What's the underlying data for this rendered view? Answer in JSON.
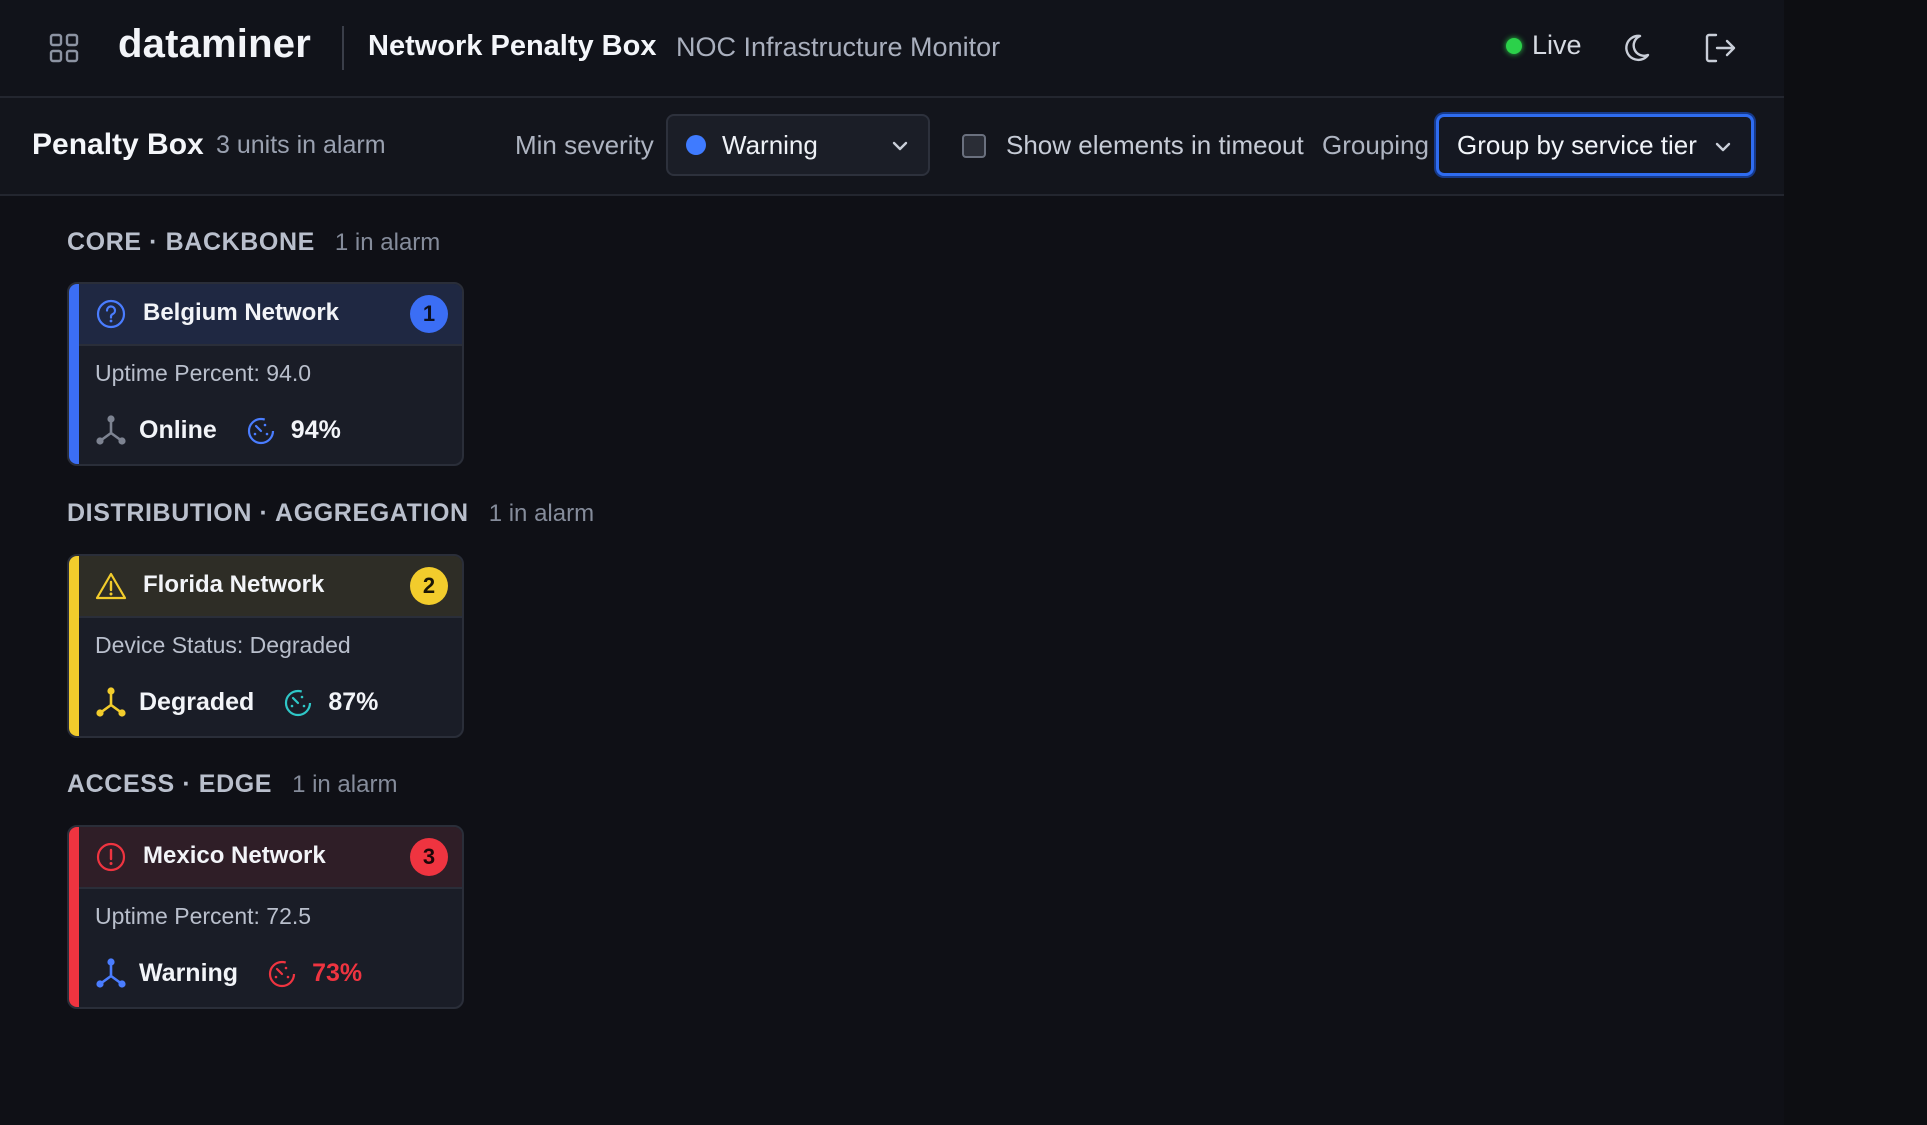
{
  "header": {
    "brand": "dataminer",
    "title": "Network Penalty Box",
    "subtitle": "NOC Infrastructure Monitor",
    "live_label": "Live",
    "icons": [
      "apps-grid-icon",
      "moon-icon",
      "logout-icon"
    ]
  },
  "toolbar": {
    "title": "Penalty Box",
    "count": "3 units in alarm",
    "severity_label": "Min severity",
    "severity_value": "Warning",
    "timeout_label": "Show elements in timeout",
    "timeout_checked": false,
    "grouping_label": "Grouping",
    "grouping_value": "Group by service tier"
  },
  "groups": [
    {
      "title": "CORE · BACKBONE",
      "count": "1 in alarm",
      "card": {
        "name": "Belgium Network",
        "badge": "1",
        "metric": "Uptime Percent: 94.0",
        "status": "Online",
        "percent": "94%",
        "icon": "question-circle-icon",
        "accent": "#3b6ef5"
      }
    },
    {
      "title": "DISTRIBUTION · AGGREGATION",
      "count": "1 in alarm",
      "card": {
        "name": "Florida Network",
        "badge": "2",
        "metric": "Device Status: Degraded",
        "status": "Degraded",
        "percent": "87%",
        "icon": "warning-triangle-icon",
        "accent": "#f2cc2c"
      }
    },
    {
      "title": "ACCESS · EDGE",
      "count": "1 in alarm",
      "card": {
        "name": "Mexico Network",
        "badge": "3",
        "metric": "Uptime Percent: 72.5",
        "status": "Warning",
        "percent": "73%",
        "icon": "alert-circle-icon",
        "accent": "#ef3440"
      }
    }
  ]
}
